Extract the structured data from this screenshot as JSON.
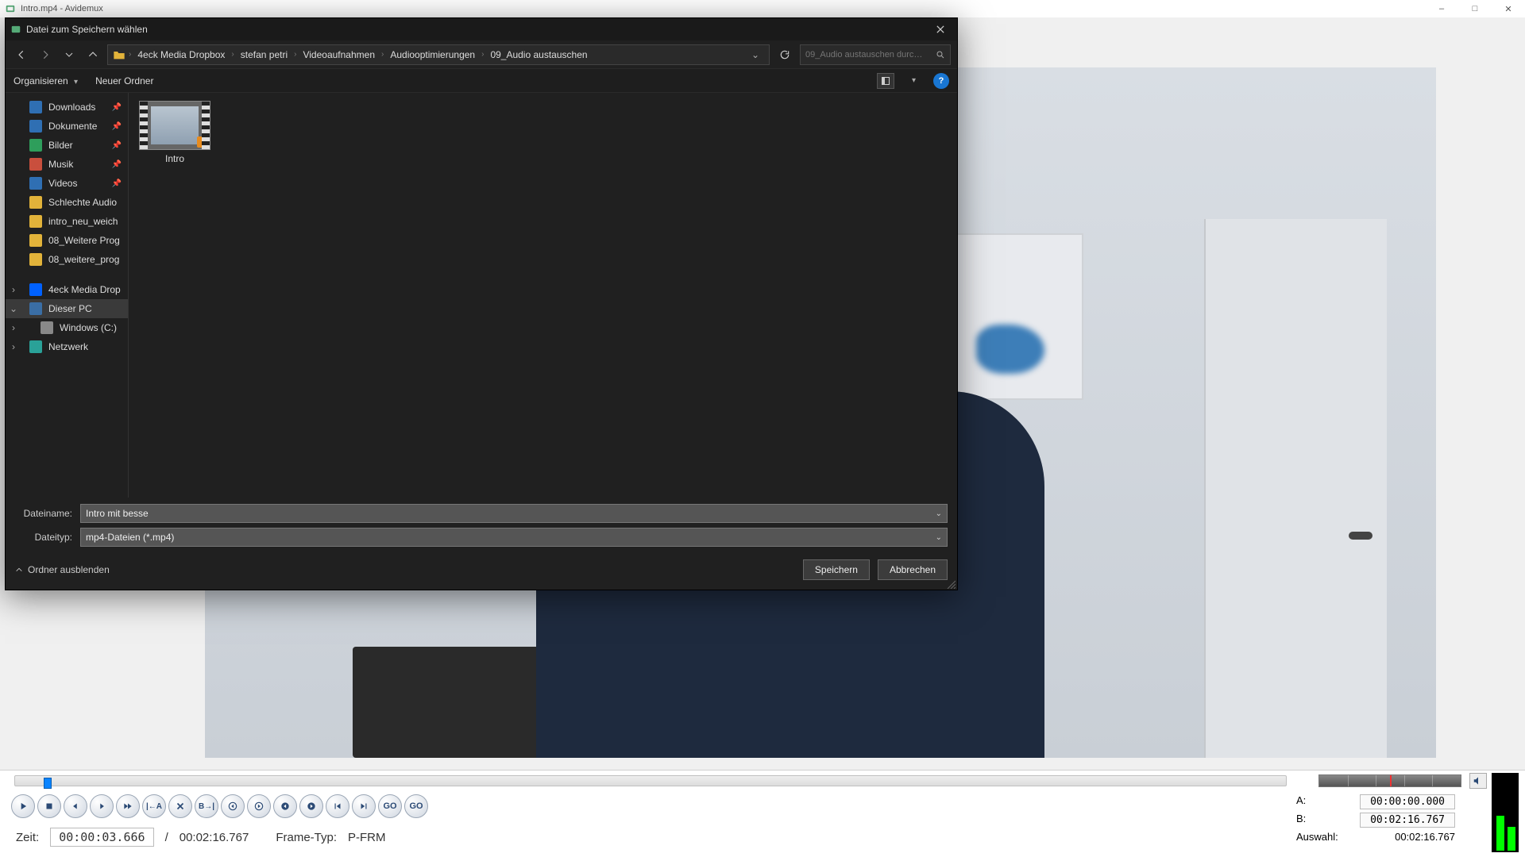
{
  "app": {
    "title": "Intro.mp4 - Avidemux"
  },
  "window_controls": {
    "min": "–",
    "max": "□",
    "close": "✕"
  },
  "dialog": {
    "title": "Datei zum Speichern wählen",
    "breadcrumb": [
      "4eck Media Dropbox",
      "stefan petri",
      "Videoaufnahmen",
      "Audiooptimierungen",
      "09_Audio austauschen"
    ],
    "search_placeholder": "09_Audio austauschen durc…",
    "toolbar": {
      "organize": "Organisieren",
      "new_folder": "Neuer Ordner"
    },
    "sidebar": {
      "quick": [
        {
          "label": "Downloads",
          "icon": "blue",
          "pinned": true
        },
        {
          "label": "Dokumente",
          "icon": "blue",
          "pinned": true
        },
        {
          "label": "Bilder",
          "icon": "green",
          "pinned": true
        },
        {
          "label": "Musik",
          "icon": "red",
          "pinned": true
        },
        {
          "label": "Videos",
          "icon": "blue",
          "pinned": true
        },
        {
          "label": "Schlechte Audio",
          "icon": "folder",
          "pinned": false
        },
        {
          "label": "intro_neu_weich",
          "icon": "folder",
          "pinned": false
        },
        {
          "label": "08_Weitere Prog",
          "icon": "folder",
          "pinned": false
        },
        {
          "label": "08_weitere_prog",
          "icon": "folder",
          "pinned": false
        }
      ],
      "locations": [
        {
          "label": "4eck Media Drop",
          "icon": "dropbox",
          "expandable": true
        },
        {
          "label": "Dieser PC",
          "icon": "pc",
          "expandable": true,
          "expanded": true
        },
        {
          "label": "Windows (C:)",
          "icon": "drive",
          "indent": true,
          "expandable": true
        },
        {
          "label": "Netzwerk",
          "icon": "net",
          "expandable": true
        }
      ]
    },
    "files": [
      {
        "name": "Intro"
      }
    ],
    "fields": {
      "name_label": "Dateiname:",
      "name_value": "Intro mit besse",
      "type_label": "Dateityp:",
      "type_value": "mp4-Dateien (*.mp4)"
    },
    "actions": {
      "hide_folders": "Ordner ausblenden",
      "save": "Speichern",
      "cancel": "Abbrechen"
    }
  },
  "bottom": {
    "zeit_label": "Zeit:",
    "zeit_value": "00:00:03.666",
    "total_sep": "/",
    "total_value": "00:02:16.767",
    "frame_label": "Frame-Typ:",
    "frame_value": "P-FRM",
    "ab": {
      "a_label": "A:",
      "a_value": "00:00:00.000",
      "b_label": "B:",
      "b_value": "00:02:16.767",
      "sel_label": "Auswahl:",
      "sel_value": "00:02:16.767"
    }
  }
}
